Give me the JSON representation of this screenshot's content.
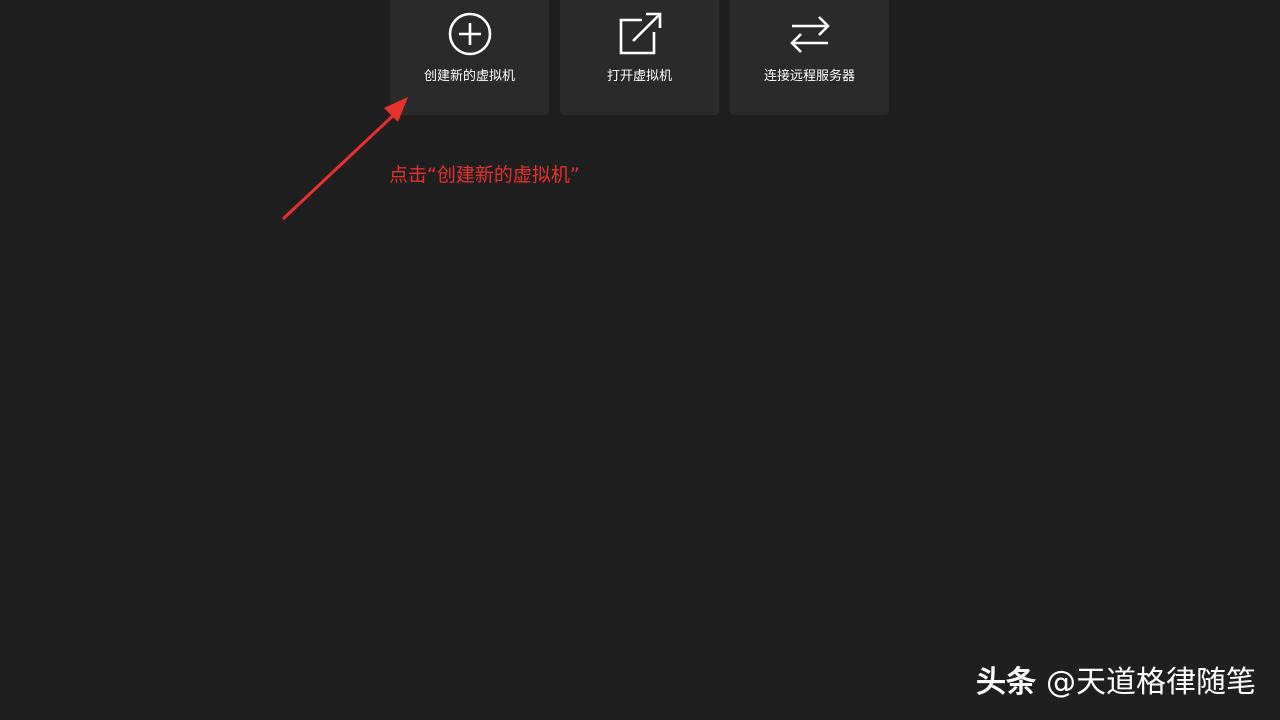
{
  "tiles": [
    {
      "label": "创建新的虚拟机",
      "icon": "plus-circle-icon"
    },
    {
      "label": "打开虚拟机",
      "icon": "open-external-icon"
    },
    {
      "label": "连接远程服务器",
      "icon": "swap-arrows-icon"
    }
  ],
  "annotation": {
    "text": "点击“创建新的虚拟机”",
    "color": "#e8312b"
  },
  "watermark": {
    "brand": "头条",
    "handle": "@天道格律随笔"
  },
  "colors": {
    "background": "#1f1f1f",
    "tile": "#2a2a2a",
    "text": "#ffffff"
  }
}
